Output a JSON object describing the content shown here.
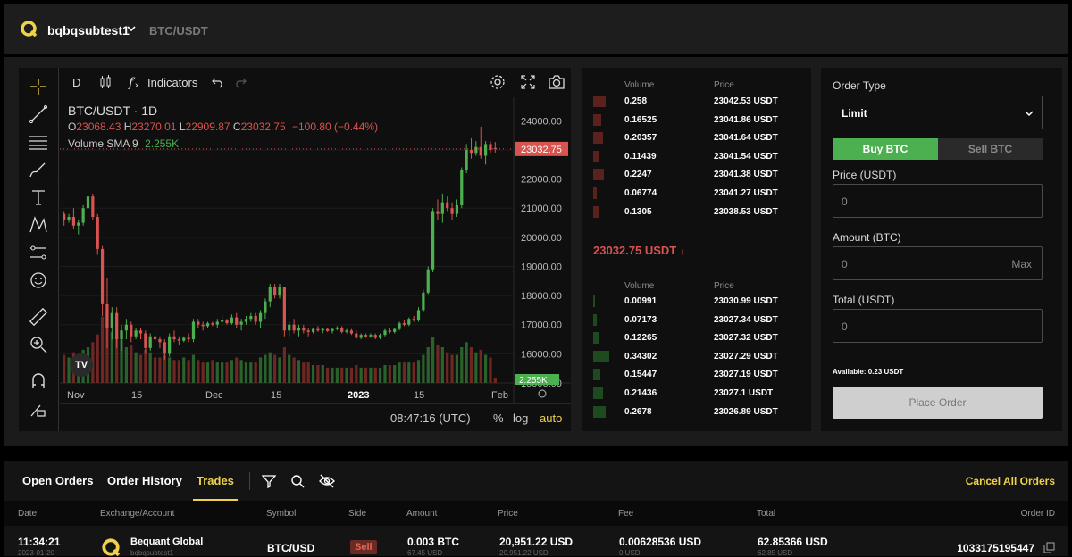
{
  "header": {
    "account": "bqbqsubtest1",
    "pair": "BTC/USDT"
  },
  "chart_toolbar": {
    "interval": "D",
    "indicators": "Indicators"
  },
  "chart_info": {
    "symbol": "BTC/USDT · 1D",
    "o_label": "O",
    "o": "23068.43",
    "h_label": "H",
    "h": "23270.01",
    "l_label": "L",
    "l": "22909.87",
    "c_label": "C",
    "c": "23032.75",
    "change": "−100.80 (−0.44%)",
    "volume_label": "Volume SMA 9",
    "volume_value": "2.255K"
  },
  "chart_bottom": {
    "time": "08:47:16 (UTC)",
    "pct": "%",
    "log": "log",
    "auto": "auto"
  },
  "chart_data": {
    "type": "candlestick",
    "y_ticks": [
      "24000.00",
      "23000.00",
      "22000.00",
      "21000.00",
      "20000.00",
      "19000.00",
      "18000.00",
      "17000.00",
      "16000.00",
      "15000.00"
    ],
    "x_ticks": [
      "Nov",
      "15",
      "Dec",
      "15",
      "2023",
      "15",
      "Feb"
    ],
    "last_price": "23032.75",
    "volume_last": "2.255K",
    "ylim": [
      15000,
      24500
    ],
    "candles": [
      [
        20800,
        20900,
        20400,
        20600
      ],
      [
        20600,
        20800,
        20500,
        20700
      ],
      [
        20700,
        21000,
        20300,
        20400
      ],
      [
        20400,
        20600,
        20100,
        20500
      ],
      [
        20500,
        21100,
        20400,
        21000
      ],
      [
        21000,
        21500,
        20800,
        21400
      ],
      [
        21400,
        21500,
        20600,
        20700
      ],
      [
        20700,
        20800,
        19400,
        19600
      ],
      [
        19600,
        19700,
        17300,
        17700
      ],
      [
        17700,
        18600,
        16200,
        16900
      ],
      [
        16900,
        17600,
        16500,
        17400
      ],
      [
        17400,
        17600,
        16200,
        16500
      ],
      [
        16500,
        17000,
        16100,
        16800
      ],
      [
        16800,
        17200,
        16500,
        17000
      ],
      [
        17000,
        17100,
        16400,
        16600
      ],
      [
        16600,
        16900,
        16500,
        16800
      ],
      [
        16800,
        16900,
        16500,
        16700
      ],
      [
        16700,
        16800,
        16000,
        16200
      ],
      [
        16200,
        16700,
        16100,
        16600
      ],
      [
        16600,
        16800,
        16400,
        16500
      ],
      [
        16500,
        16600,
        16200,
        16400
      ],
      [
        16400,
        16500,
        15800,
        16000
      ],
      [
        16000,
        16700,
        15900,
        16600
      ],
      [
        16600,
        16800,
        16400,
        16500
      ],
      [
        16500,
        16600,
        16300,
        16450
      ],
      [
        16450,
        16600,
        16400,
        16550
      ],
      [
        16550,
        16700,
        16400,
        16500
      ],
      [
        16500,
        17200,
        16400,
        17100
      ],
      [
        17100,
        17200,
        16900,
        17000
      ],
      [
        17000,
        17100,
        16800,
        16950
      ],
      [
        16950,
        17100,
        16900,
        17050
      ],
      [
        17050,
        17100,
        16950,
        17000
      ],
      [
        17000,
        17200,
        16900,
        17100
      ],
      [
        17100,
        17300,
        17000,
        17150
      ],
      [
        17150,
        17200,
        17000,
        17050
      ],
      [
        17050,
        17350,
        17000,
        17250
      ],
      [
        17250,
        17400,
        16900,
        17000
      ],
      [
        17000,
        17200,
        16800,
        17100
      ],
      [
        17100,
        17300,
        17000,
        17200
      ],
      [
        17200,
        17400,
        17100,
        17300
      ],
      [
        17300,
        17400,
        17000,
        17100
      ],
      [
        17100,
        17500,
        16900,
        17400
      ],
      [
        17400,
        17900,
        17200,
        17800
      ],
      [
        17800,
        18400,
        17600,
        18300
      ],
      [
        18300,
        18400,
        17900,
        18000
      ],
      [
        18000,
        18400,
        17900,
        18300
      ],
      [
        18300,
        18300,
        16600,
        16800
      ],
      [
        16800,
        17100,
        16600,
        17000
      ],
      [
        17000,
        17200,
        16700,
        16800
      ],
      [
        16800,
        17000,
        16600,
        16900
      ],
      [
        16900,
        17000,
        16700,
        16800
      ],
      [
        16800,
        16900,
        16600,
        16750
      ],
      [
        16750,
        16900,
        16700,
        16850
      ],
      [
        16850,
        16950,
        16750,
        16800
      ],
      [
        16800,
        16900,
        16700,
        16850
      ],
      [
        16850,
        16900,
        16750,
        16780
      ],
      [
        16780,
        16900,
        16700,
        16850
      ],
      [
        16850,
        16950,
        16800,
        16900
      ],
      [
        16900,
        16950,
        16700,
        16750
      ],
      [
        16750,
        16850,
        16700,
        16800
      ],
      [
        16800,
        16850,
        16650,
        16700
      ],
      [
        16700,
        16800,
        16500,
        16550
      ],
      [
        16550,
        16700,
        16500,
        16650
      ],
      [
        16650,
        16700,
        16550,
        16600
      ],
      [
        16600,
        16700,
        16550,
        16650
      ],
      [
        16650,
        16700,
        16500,
        16550
      ],
      [
        16550,
        16700,
        16500,
        16650
      ],
      [
        16650,
        16850,
        16600,
        16800
      ],
      [
        16800,
        16900,
        16700,
        16750
      ],
      [
        16750,
        16900,
        16700,
        16850
      ],
      [
        16850,
        17100,
        16800,
        17050
      ],
      [
        17050,
        17150,
        16950,
        17000
      ],
      [
        17000,
        17250,
        16950,
        17200
      ],
      [
        17200,
        17300,
        17100,
        17150
      ],
      [
        17150,
        17600,
        17100,
        17500
      ],
      [
        17500,
        18200,
        17450,
        18100
      ],
      [
        18100,
        19000,
        18050,
        18900
      ],
      [
        18900,
        21000,
        18800,
        20900
      ],
      [
        20900,
        21300,
        20600,
        20800
      ],
      [
        20800,
        21500,
        20500,
        21200
      ],
      [
        21200,
        21400,
        20900,
        21000
      ],
      [
        21000,
        21200,
        20600,
        20800
      ],
      [
        20800,
        21300,
        20700,
        21100
      ],
      [
        21100,
        22400,
        21000,
        22300
      ],
      [
        22300,
        23200,
        22200,
        23000
      ],
      [
        23000,
        23400,
        22700,
        22900
      ],
      [
        22900,
        23300,
        22800,
        23100
      ],
      [
        23100,
        23800,
        22700,
        22800
      ],
      [
        22800,
        23300,
        22500,
        23200
      ],
      [
        23200,
        23300,
        22900,
        23000
      ],
      [
        23068.43,
        23270.01,
        22909.87,
        23032.75
      ]
    ],
    "volumes": [
      0.55,
      0.5,
      0.6,
      0.55,
      0.65,
      0.7,
      0.8,
      0.95,
      1.3,
      1.4,
      1.0,
      0.9,
      0.85,
      0.7,
      0.75,
      0.6,
      0.55,
      0.65,
      0.6,
      0.5,
      0.5,
      0.55,
      0.5,
      0.45,
      0.45,
      0.5,
      0.45,
      0.55,
      0.45,
      0.4,
      0.4,
      0.45,
      0.4,
      0.4,
      0.4,
      0.45,
      0.5,
      0.45,
      0.4,
      0.4,
      0.4,
      0.5,
      0.55,
      0.6,
      0.55,
      0.5,
      0.7,
      0.55,
      0.5,
      0.45,
      0.4,
      0.4,
      0.35,
      0.35,
      0.35,
      0.3,
      0.3,
      0.3,
      0.3,
      0.3,
      0.3,
      0.35,
      0.3,
      0.3,
      0.3,
      0.3,
      0.3,
      0.35,
      0.35,
      0.35,
      0.4,
      0.4,
      0.4,
      0.4,
      0.45,
      0.55,
      0.7,
      0.9,
      0.75,
      0.7,
      0.6,
      0.55,
      0.55,
      0.7,
      0.8,
      0.7,
      0.6,
      0.65,
      0.55,
      0.5,
      0.1
    ]
  },
  "orderbook": {
    "volume_header": "Volume",
    "price_header": "Price",
    "asks": [
      {
        "volume": "0.258",
        "price": "23042.53 USDT",
        "size": 0.75
      },
      {
        "volume": "0.16525",
        "price": "23041.86 USDT",
        "size": 0.48
      },
      {
        "volume": "0.20357",
        "price": "23041.64 USDT",
        "size": 0.59
      },
      {
        "volume": "0.11439",
        "price": "23041.54 USDT",
        "size": 0.33
      },
      {
        "volume": "0.2247",
        "price": "23041.38 USDT",
        "size": 0.65
      },
      {
        "volume": "0.06774",
        "price": "23041.27 USDT",
        "size": 0.2
      },
      {
        "volume": "0.1305",
        "price": "23038.53 USDT",
        "size": 0.38
      }
    ],
    "mid_price": "23032.75 USDT",
    "bids": [
      {
        "volume": "0.00991",
        "price": "23030.99 USDT",
        "size": 0.05
      },
      {
        "volume": "0.07173",
        "price": "23027.34 USDT",
        "size": 0.21
      },
      {
        "volume": "0.12265",
        "price": "23027.32 USDT",
        "size": 0.36
      },
      {
        "volume": "0.34302",
        "price": "23027.29 USDT",
        "size": 1.0
      },
      {
        "volume": "0.15447",
        "price": "23027.19 USDT",
        "size": 0.45
      },
      {
        "volume": "0.21436",
        "price": "23027.1 USDT",
        "size": 0.62
      },
      {
        "volume": "0.2678",
        "price": "23026.89 USDT",
        "size": 0.78
      }
    ]
  },
  "order_form": {
    "order_type_label": "Order Type",
    "order_type_value": "Limit",
    "buy_label": "Buy BTC",
    "sell_label": "Sell BTC",
    "price_label": "Price (USDT)",
    "price_placeholder": "0",
    "amount_label": "Amount (BTC)",
    "amount_placeholder": "0",
    "max_label": "Max",
    "total_label": "Total (USDT)",
    "total_placeholder": "0",
    "available": "Available: 0.23 USDT",
    "place_label": "Place Order"
  },
  "orders": {
    "tabs": [
      "Open Orders",
      "Order History",
      "Trades"
    ],
    "cancel_all": "Cancel All Orders",
    "columns": [
      "Date",
      "Exchange/Account",
      "Symbol",
      "Side",
      "Amount",
      "Price",
      "Fee",
      "Total",
      "Order ID"
    ],
    "row": {
      "time": "11:34:21",
      "date": "2023-01-20",
      "exchange": "Bequant Global",
      "account": "bqbqsubtest1",
      "symbol": "BTC/USD",
      "side": "Sell",
      "amount": "0.003 BTC",
      "amount_sub": "67.45 USD",
      "price": "20,951.22 USD",
      "price_sub": "20,951.22 USD",
      "fee": "0.00628536 USD",
      "fee_sub": "0 USD",
      "total": "62.85366 USD",
      "total_sub": "62.85 USD",
      "order_id": "1033175195447"
    }
  },
  "colors": {
    "accent": "#f0d24a",
    "buy": "#4caf50",
    "sell": "#d9534f",
    "up": "#4caf50",
    "down": "#d9534f"
  }
}
